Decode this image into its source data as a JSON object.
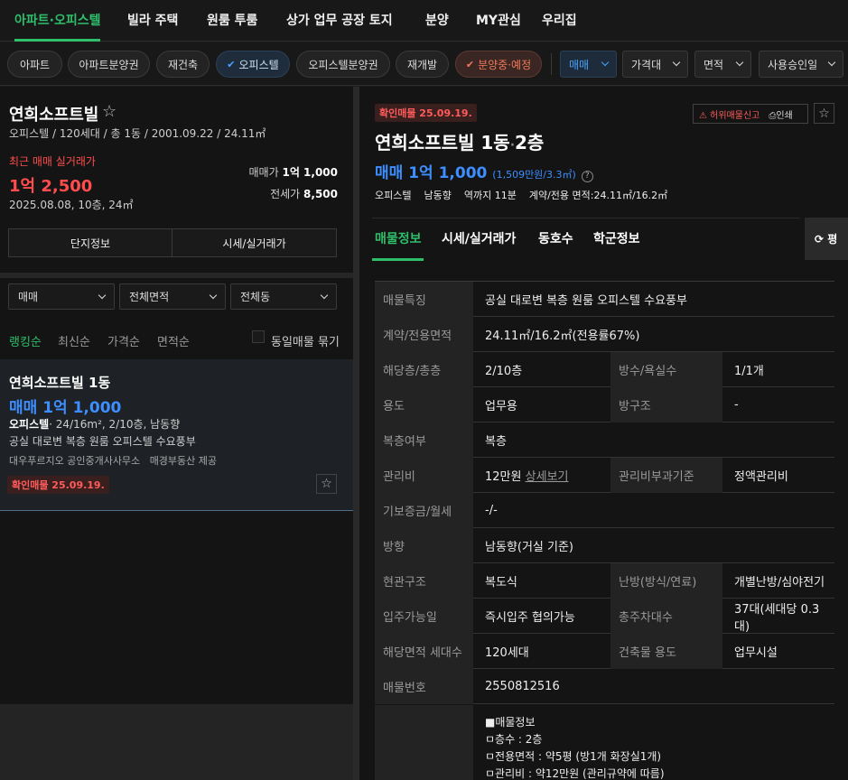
{
  "nav": {
    "tabs": [
      "아파트·오피스텔",
      "빌라 주택",
      "원룸 투룸",
      "상가 업무 공장 토지",
      "분양",
      "MY관심",
      "우리집"
    ]
  },
  "filters": {
    "chips": [
      "아파트",
      "아파트분양권",
      "재건축",
      "오피스텔",
      "오피스텔분양권",
      "재개발",
      "분양중·예정"
    ],
    "dropdowns": [
      "매매",
      "가격대",
      "면적",
      "사용승인일"
    ]
  },
  "complex": {
    "name": "연희소프트빌",
    "info": "오피스텔 / 120세대 / 총 1동 / 2001.09.22 / 24.11㎡",
    "recent_label": "최근 매매 실거래가",
    "recent_price": "1억 2,500",
    "recent_detail": "2025.08.08, 10층, 24㎡",
    "sale_label": "매매가",
    "sale_value": "1억 1,000",
    "jeonse_label": "전세가",
    "jeonse_value": "8,500",
    "btn_info": "단지정보",
    "btn_price": "시세/실거래가"
  },
  "list_filters": {
    "selects": [
      "매매",
      "전체면적",
      "전체동"
    ],
    "sorts": [
      "랭킹순",
      "최신순",
      "가격순",
      "면적순"
    ],
    "group_label": "동일매물 묶기"
  },
  "listing_card": {
    "title": "연희소프트빌 1동",
    "price": "매매 1억 1,000",
    "type": "오피스텔",
    "spec": "· 24/16m², 2/10층, 남동향",
    "desc": "공실 대로변 복층 원룸 오피스텔 수요풍부",
    "agent1": "대우푸르지오 공인중개사사무소",
    "agent2": "매경부동산 제공",
    "badge": "확인매물 25.09.19."
  },
  "detail": {
    "badge": "확인매물 25.09.19.",
    "report": "허위매물신고",
    "print": "인쇄",
    "title_main": "연희소프트빌 1동",
    "title_dot": "·",
    "title_floor": "2층",
    "price": "매매 1억 1,000",
    "price_per": "(1,509만원/3.3㎡)",
    "summary": [
      "오피스텔",
      "남동향",
      "역까지 11분",
      "계약/전용 면적:24.11㎡/16.2㎡"
    ],
    "tabs": [
      "매물정보",
      "시세/실거래가",
      "동호수",
      "학군정보"
    ],
    "refresh": "평",
    "rows": [
      {
        "k1": "매물특징",
        "v1": "공실 대로변 복층 원룸 오피스텔 수요풍부"
      },
      {
        "k1": "계약/전용면적",
        "v1": "24.11㎡/16.2㎡(전용률67%)"
      },
      {
        "k1": "해당층/총층",
        "v1": "2/10층",
        "k2": "방수/욕실수",
        "v2": "1/1개"
      },
      {
        "k1": "용도",
        "v1": "업무용",
        "k2": "방구조",
        "v2": "-"
      },
      {
        "k1": "복층여부",
        "v1": "복층"
      },
      {
        "k1": "관리비",
        "v1": "12만원",
        "link": "상세보기",
        "k2": "관리비부과기준",
        "v2": "정액관리비"
      },
      {
        "k1": "기보증금/월세",
        "v1": "-/-"
      },
      {
        "k1": "방향",
        "v1": "남동향(거실 기준)"
      },
      {
        "k1": "현관구조",
        "v1": "복도식",
        "k2": "난방(방식/연료)",
        "v2": "개별난방/심야전기"
      },
      {
        "k1": "입주가능일",
        "v1": "즉시입주 협의가능",
        "k2": "총주차대수",
        "v2": "37대(세대당 0.3대)"
      },
      {
        "k1": "해당면적 세대수",
        "v1": "120세대",
        "k2": "건축물 용도",
        "v2": "업무시설"
      },
      {
        "k1": "매물번호",
        "v1": "2550812516"
      }
    ],
    "desc_lines": [
      "■매물정보",
      "ㅁ층수 : 2층",
      "ㅁ전용면적 : 약5평 (방1개 화장실1개)",
      "ㅁ관리비 : 약12만원 (관리규약에 따름)"
    ]
  }
}
